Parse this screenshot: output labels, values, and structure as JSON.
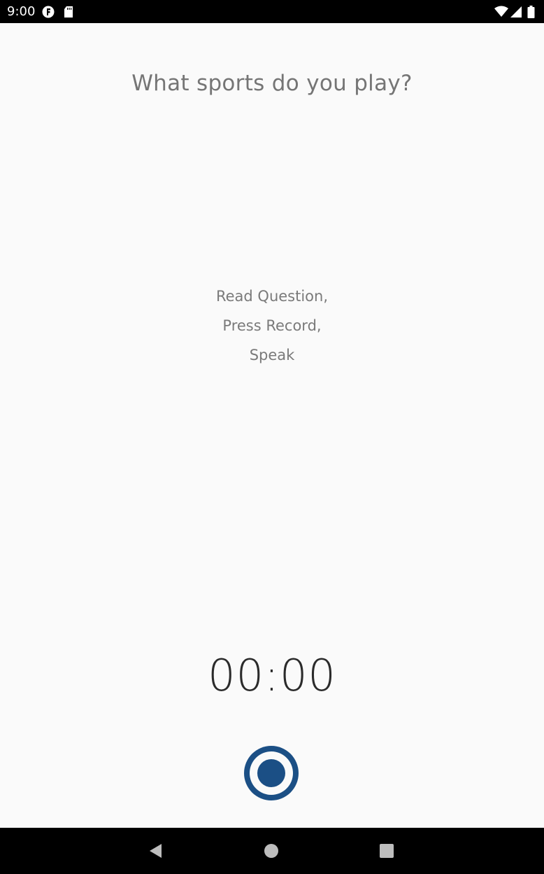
{
  "status_bar": {
    "time": "9:00",
    "icons": [
      "notification-f-icon",
      "sd-card-icon",
      "wifi-icon",
      "signal-icon",
      "battery-icon"
    ]
  },
  "question": {
    "text": "What sports do you play?"
  },
  "instructions": {
    "lines": [
      "Read Question,",
      "Press Record,",
      "Speak"
    ]
  },
  "timer": {
    "value": "00:00"
  },
  "record_button": {
    "icon": "record-icon",
    "color": "#1b4f85"
  },
  "nav_bar": {
    "buttons": [
      "back-icon",
      "home-icon",
      "recents-icon"
    ]
  }
}
